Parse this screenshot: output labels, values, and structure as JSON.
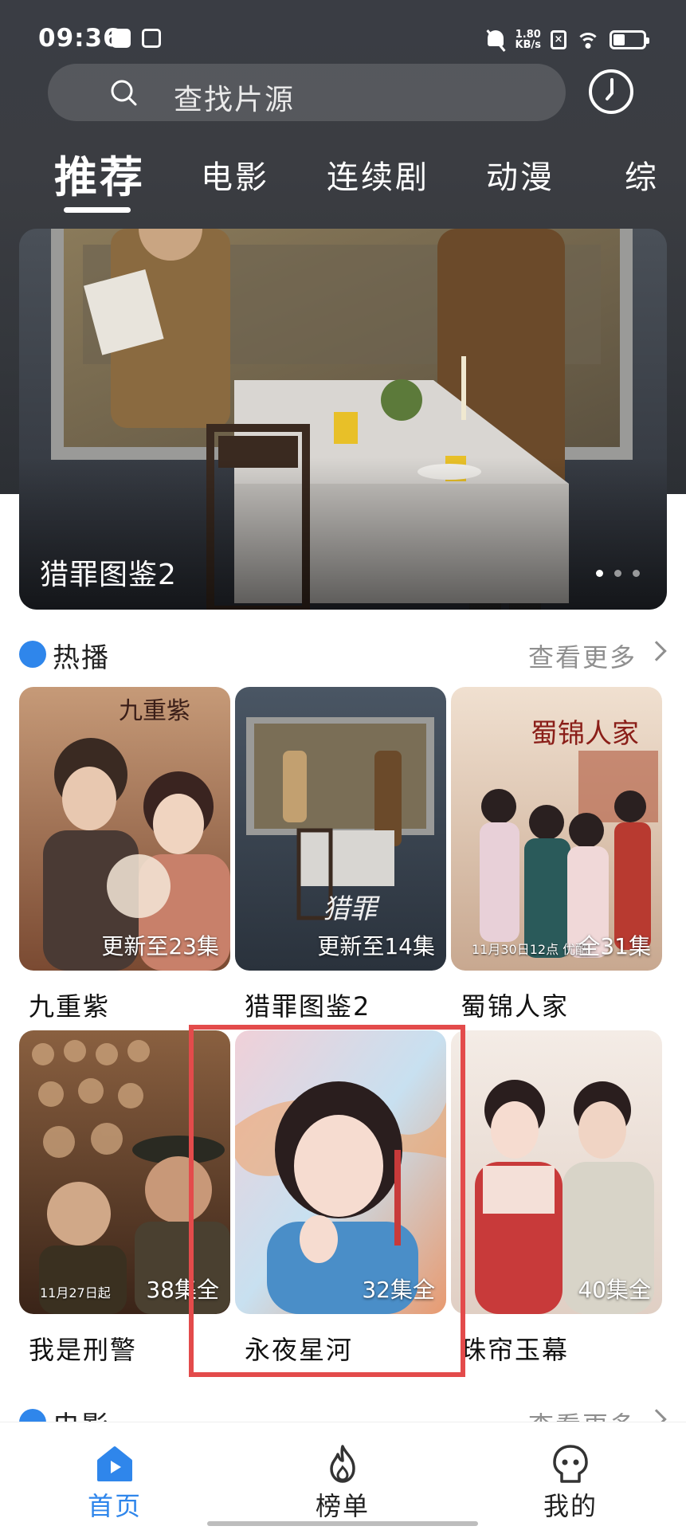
{
  "status_bar": {
    "time": "09:36",
    "net_speed_value": "1.80",
    "net_speed_unit": "KB/s",
    "icons": [
      "message-icon",
      "bag-icon",
      "mute-icon",
      "sim-off-icon",
      "wifi-icon",
      "battery-icon"
    ]
  },
  "search": {
    "placeholder": "查找片源"
  },
  "tabs": [
    {
      "label": "推荐",
      "active": true
    },
    {
      "label": "电影",
      "active": false
    },
    {
      "label": "连续剧",
      "active": false
    },
    {
      "label": "动漫",
      "active": false
    },
    {
      "label": "综",
      "active": false
    }
  ],
  "banner": {
    "title": "猎罪图鉴2",
    "slide_count": 3,
    "active_slide": 1
  },
  "hot_section": {
    "title": "热播",
    "more_label": "查看更多",
    "items": [
      {
        "title": "九重紫",
        "badge": "更新至23集",
        "poster_text": "九重紫"
      },
      {
        "title": "猎罪图鉴2",
        "badge": "更新至14集",
        "poster_text": "猎罪"
      },
      {
        "title": "蜀锦人家",
        "badge": "全31集",
        "poster_text": "蜀锦人家",
        "poster_date": "11月30日12点 优酷"
      },
      {
        "title": "我是刑警",
        "badge": "38集全",
        "poster_date": "11月27日起"
      },
      {
        "title": "永夜星河",
        "badge": "32集全"
      },
      {
        "title": "珠帘玉幕",
        "badge": "40集全"
      }
    ]
  },
  "movie_section": {
    "title": "电影",
    "more_label": "查看更多"
  },
  "bottom_nav": [
    {
      "label": "首页",
      "icon": "home-play-icon",
      "active": true
    },
    {
      "label": "榜单",
      "icon": "flame-icon",
      "active": false
    },
    {
      "label": "我的",
      "icon": "profile-icon",
      "active": false
    }
  ],
  "colors": {
    "accent": "#2f86eb",
    "highlight": "#e34b4b",
    "header_bg": "#3a3d44"
  }
}
